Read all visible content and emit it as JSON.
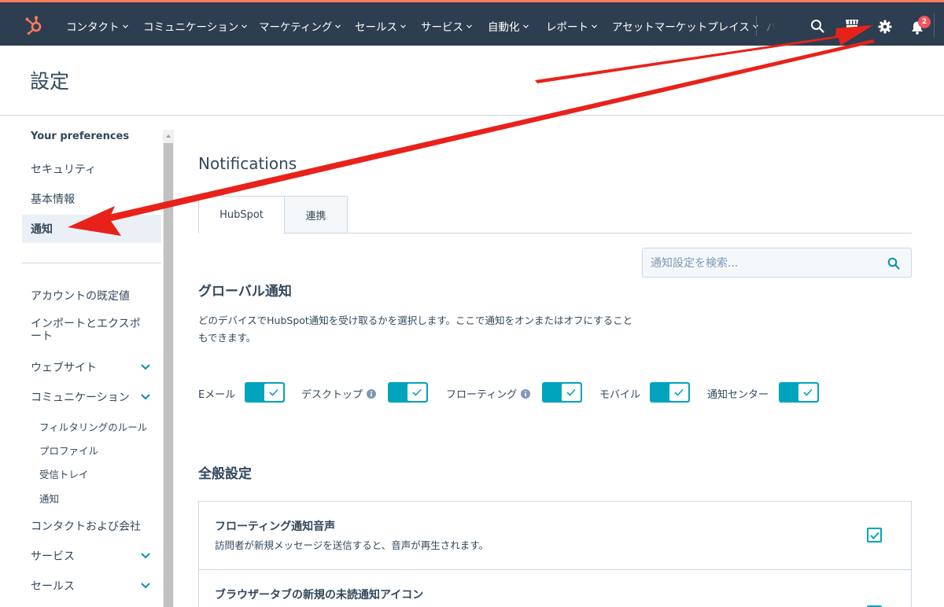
{
  "topnav": {
    "items": [
      {
        "label": "コンタクト",
        "has_menu": true
      },
      {
        "label": "コミュニケーション",
        "has_menu": true
      },
      {
        "label": "マーケティング",
        "has_menu": true
      },
      {
        "label": "セールス",
        "has_menu": true
      },
      {
        "label": "サービス",
        "has_menu": true
      },
      {
        "label": "自動化",
        "has_menu": true
      },
      {
        "label": "レポート",
        "has_menu": true
      },
      {
        "label": "アセットマーケットプレイス",
        "has_menu": true
      },
      {
        "label": "パート",
        "has_menu": false
      }
    ],
    "icons": [
      "hubspot-logo-icon",
      "search-icon",
      "marketplace-icon",
      "gear-icon",
      "bell-icon"
    ],
    "notification_count": "2"
  },
  "header": {
    "title": "設定"
  },
  "sidebar": {
    "heading": "Your preferences",
    "preferences": [
      {
        "label": "セキュリティ"
      },
      {
        "label": "基本情報"
      },
      {
        "label": "通知",
        "active": true
      }
    ],
    "account": [
      {
        "label": "アカウントの既定値"
      },
      {
        "label": "インポートとエクスポート"
      },
      {
        "label": "ウェブサイト",
        "expandable": true
      },
      {
        "label": "コミュニケーション",
        "expandable": true
      },
      {
        "label": "コンタクトおよび会社"
      },
      {
        "label": "サービス",
        "expandable": true
      },
      {
        "label": "セールス",
        "expandable": true
      }
    ],
    "communication_subitems": [
      {
        "label": "フィルタリングのルール"
      },
      {
        "label": "プロファイル"
      },
      {
        "label": "受信トレイ"
      },
      {
        "label": "通知"
      }
    ]
  },
  "main": {
    "title": "Notifications",
    "tabs": [
      {
        "label": "HubSpot",
        "active": true
      },
      {
        "label": "連携",
        "active": false
      }
    ],
    "search": {
      "placeholder": "通知設定を検索...",
      "value": ""
    },
    "global": {
      "heading": "グローバル通知",
      "description": "どのデバイスでHubSpot通知を受け取るかを選択します。ここで通知をオンまたはオフにすることもできます。",
      "toggles": [
        {
          "label": "Eメール",
          "on": true,
          "info": false
        },
        {
          "label": "デスクトップ",
          "on": true,
          "info": true
        },
        {
          "label": "フローティング",
          "on": true,
          "info": true
        },
        {
          "label": "モバイル",
          "on": true,
          "info": false
        },
        {
          "label": "通知センター",
          "on": true,
          "info": false
        }
      ]
    },
    "general": {
      "heading": "全般設定",
      "settings": [
        {
          "title": "フローティング通知音声",
          "description": "訪問者が新規メッセージを送信すると、音声が再生されます。",
          "checked": true
        },
        {
          "title": "ブラウザータブの新規の未読通知アイコン",
          "description": "",
          "checked": true
        }
      ]
    }
  },
  "colors": {
    "nav_bg": "#2d3e50",
    "accent": "#00a4bd",
    "annotation_arrow": "#e8221a",
    "active_bg": "#eaf0f6",
    "badge": "#f2545b"
  }
}
